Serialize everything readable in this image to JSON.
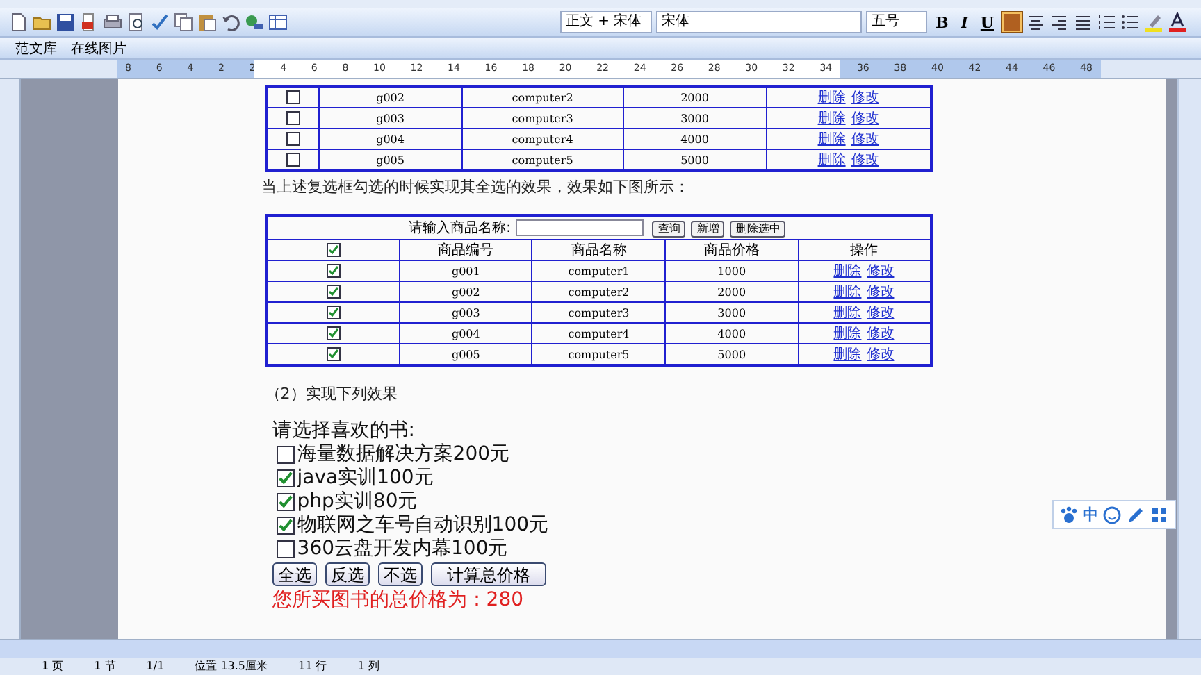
{
  "toolbar": {
    "style": "正文 + 宋体",
    "font": "宋体",
    "size": "五号",
    "format_buttons": [
      "B",
      "I",
      "U"
    ]
  },
  "toolbar2": [
    {
      "label": "范文库"
    },
    {
      "label": "在线图片"
    }
  ],
  "ruler": {
    "labels": [
      "8",
      "6",
      "4",
      "2",
      "2",
      "4",
      "6",
      "8",
      "10",
      "12",
      "14",
      "16",
      "18",
      "20",
      "22",
      "24",
      "26",
      "28",
      "30",
      "32",
      "34",
      "36",
      "38",
      "40",
      "42",
      "44",
      "46",
      "48"
    ]
  },
  "table1": {
    "rows": [
      {
        "checked": false,
        "id": "g002",
        "name": "computer2",
        "price": "2000",
        "actions": [
          "删除",
          "修改"
        ]
      },
      {
        "checked": false,
        "id": "g003",
        "name": "computer3",
        "price": "3000",
        "actions": [
          "删除",
          "修改"
        ]
      },
      {
        "checked": false,
        "id": "g004",
        "name": "computer4",
        "price": "4000",
        "actions": [
          "删除",
          "修改"
        ]
      },
      {
        "checked": false,
        "id": "g005",
        "name": "computer5",
        "price": "5000",
        "actions": [
          "删除",
          "修改"
        ]
      }
    ]
  },
  "para1": "当上述复选框勾选的时候实现其全选的效果，效果如下图所示：",
  "table2": {
    "search_label": "请输入商品名称:",
    "buttons": [
      "查询",
      "新增",
      "删除选中"
    ],
    "header_checked": true,
    "columns": [
      "商品编号",
      "商品名称",
      "商品价格",
      "操作"
    ],
    "rows": [
      {
        "checked": true,
        "id": "g001",
        "name": "computer1",
        "price": "1000",
        "actions": [
          "删除",
          "修改"
        ]
      },
      {
        "checked": true,
        "id": "g002",
        "name": "computer2",
        "price": "2000",
        "actions": [
          "删除",
          "修改"
        ]
      },
      {
        "checked": true,
        "id": "g003",
        "name": "computer3",
        "price": "3000",
        "actions": [
          "删除",
          "修改"
        ]
      },
      {
        "checked": true,
        "id": "g004",
        "name": "computer4",
        "price": "4000",
        "actions": [
          "删除",
          "修改"
        ]
      },
      {
        "checked": true,
        "id": "g005",
        "name": "computer5",
        "price": "5000",
        "actions": [
          "删除",
          "修改"
        ]
      }
    ]
  },
  "para2": "（2）实现下列效果",
  "books_title": "请选择喜欢的书:",
  "books": [
    {
      "label": "海量数据解决方案200元",
      "checked": false
    },
    {
      "label": "java实训100元",
      "checked": true
    },
    {
      "label": "php实训80元",
      "checked": true
    },
    {
      "label": "物联网之车号自动识别100元",
      "checked": true
    },
    {
      "label": "360云盘开发内幕100元",
      "checked": false
    }
  ],
  "book_buttons": [
    "全选",
    "反选",
    "不选",
    "计算总价格"
  ],
  "total": "您所买图书的总价格为：280",
  "ime": {
    "label": "中"
  },
  "status_bar": [
    "1 页",
    "1 节",
    "1/1",
    "位置 13.5厘米",
    "11 行",
    "1 列"
  ]
}
